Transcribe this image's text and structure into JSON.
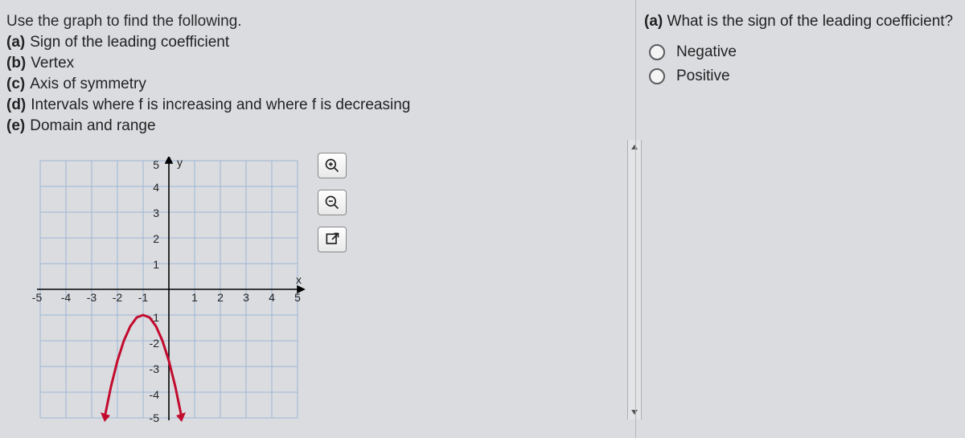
{
  "left": {
    "intro": "Use the graph to find the following.",
    "parts": [
      {
        "letter": "(a)",
        "text": "Sign of the leading coefficient"
      },
      {
        "letter": "(b)",
        "text": "Vertex"
      },
      {
        "letter": "(c)",
        "text": "Axis of symmetry"
      },
      {
        "letter": "(d)",
        "text": "Intervals where f is increasing and where f is decreasing"
      },
      {
        "letter": "(e)",
        "text": "Domain and range"
      }
    ]
  },
  "right": {
    "question_letter": "(a)",
    "question_text": "What is the sign of the leading coefficient?",
    "options": [
      "Negative",
      "Positive"
    ]
  },
  "chart_data": {
    "type": "line",
    "title": "",
    "xlabel": "x",
    "ylabel": "y",
    "xlim": [
      -5,
      5
    ],
    "ylim": [
      -5,
      5
    ],
    "x_ticks": [
      -5,
      -4,
      -3,
      -2,
      -1,
      1,
      2,
      3,
      4,
      5
    ],
    "y_ticks": [
      -5,
      -4,
      -3,
      -2,
      -1,
      1,
      2,
      3,
      4,
      5
    ],
    "series": [
      {
        "name": "f",
        "color": "#c30b2e",
        "x": [
          -2.5,
          -2.25,
          -2,
          -1.75,
          -1.5,
          -1.25,
          -1,
          -0.75,
          -0.5,
          -0.25,
          0,
          0.25,
          0.5
        ],
        "values": [
          -5,
          -3.78,
          -2.78,
          -2,
          -1.44,
          -1.11,
          -1,
          -1.11,
          -1.44,
          -2,
          -2.78,
          -3.78,
          -5
        ]
      }
    ],
    "arrows_on_ends": true
  }
}
